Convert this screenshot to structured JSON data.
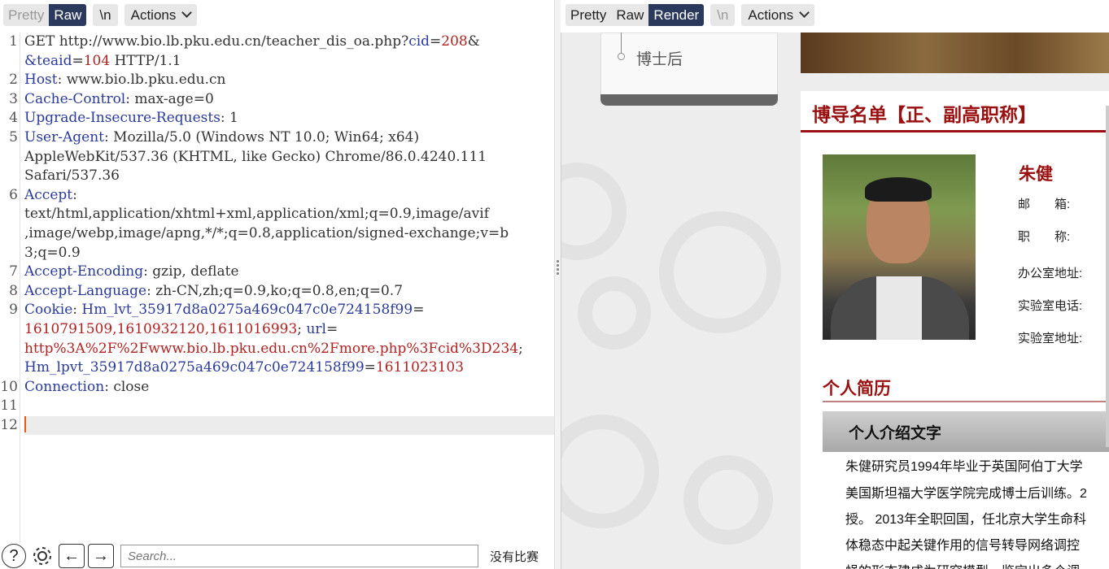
{
  "left_toolbar": {
    "pretty": "Pretty",
    "raw": "Raw",
    "newline": "\\n",
    "actions": "Actions"
  },
  "right_toolbar": {
    "pretty": "Pretty",
    "raw": "Raw",
    "render": "Render",
    "newline": "\\n",
    "actions": "Actions"
  },
  "request": {
    "line_numbers": [
      "1",
      "2",
      "3",
      "4",
      "5",
      "6",
      "7",
      "8",
      "9",
      "10",
      "11",
      "12"
    ],
    "line1_a": "GET http://www.bio.lb.pku.edu.cn/teacher_dis_oa.php?",
    "line1_k1": "cid",
    "line1_eq": "=",
    "line1_v1": "208",
    "line1_amp": "&",
    "line1b_k": "&teaid",
    "line1b_eq": "=",
    "line1b_v": "104",
    "line1b_rest": " HTTP/1.1",
    "host_k": "Host",
    "host_v": ": www.bio.lb.pku.edu.cn",
    "cc_k": "Cache-Control",
    "cc_v": ": max-age=0",
    "uir_k": "Upgrade-Insecure-Requests",
    "uir_v": ": 1",
    "ua_k": "User-Agent",
    "ua_v1": ": Mozilla/5.0 (Windows NT 10.0; Win64; x64)",
    "ua_v2": "AppleWebKit/537.36 (KHTML, like Gecko) Chrome/86.0.4240.111",
    "ua_v3": "Safari/537.36",
    "accept_k": "Accept",
    "accept_v0": ":",
    "accept_v1": "text/html,application/xhtml+xml,application/xml;q=0.9,image/avif",
    "accept_v2": ",image/webp,image/apng,*/*;q=0.8,application/signed-exchange;v=b",
    "accept_v3": "3;q=0.9",
    "ae_k": "Accept-Encoding",
    "ae_v": ": gzip, deflate",
    "al_k": "Accept-Language",
    "al_v": ": zh-CN,zh;q=0.9,ko;q=0.8,en;q=0.7",
    "cookie_k": "Cookie",
    "cookie_sep": ": ",
    "cookie_k1": "Hm_lvt_35917d8a0275a469c047c0e724158f99",
    "cookie_eq1": "=",
    "cookie_v1": "1610791509,1610932120,1611016993",
    "cookie_sep2": "; ",
    "cookie_k2": "url",
    "cookie_eq2": "=",
    "cookie_v2": "http%3A%2F%2Fwww.bio.lb.pku.edu.cn%2Fmore.php%3Fcid%3D234",
    "cookie_sep3": ";",
    "cookie_k3": "Hm_lpvt_35917d8a0275a469c047c0e724158f99",
    "cookie_eq3": "=",
    "cookie_v3": "1611023103",
    "conn_k": "Connection",
    "conn_v": ": close"
  },
  "search": {
    "placeholder": "Search...",
    "match_text": "没有比赛"
  },
  "render": {
    "sidebar_item": "博士后",
    "heading": "博导名单【正、副高职称】",
    "name": "朱健",
    "fields": [
      "邮　　箱:",
      "职　　称:",
      "办公室地址:",
      "实验室电话:",
      "实验室地址:"
    ],
    "section_title": "个人简历",
    "intro_title": "个人介绍文字",
    "paragraph": [
      "朱健研究员1994年毕业于英国阿伯丁大学",
      "美国斯坦福大学医学院完成博士后训练。2",
      "授。 2013年全职回国，任北京大学生命科",
      "体稳态中起关键作用的信号转导网络调控",
      "蝇的形态建成为研究模型，鉴定出多个调"
    ]
  },
  "colors": {
    "accent_dark": "#2b3a5c",
    "header_key": "#2a3a9a",
    "header_value": "#b22222",
    "site_red": "#9a1010",
    "caret": "#e25a1c"
  }
}
